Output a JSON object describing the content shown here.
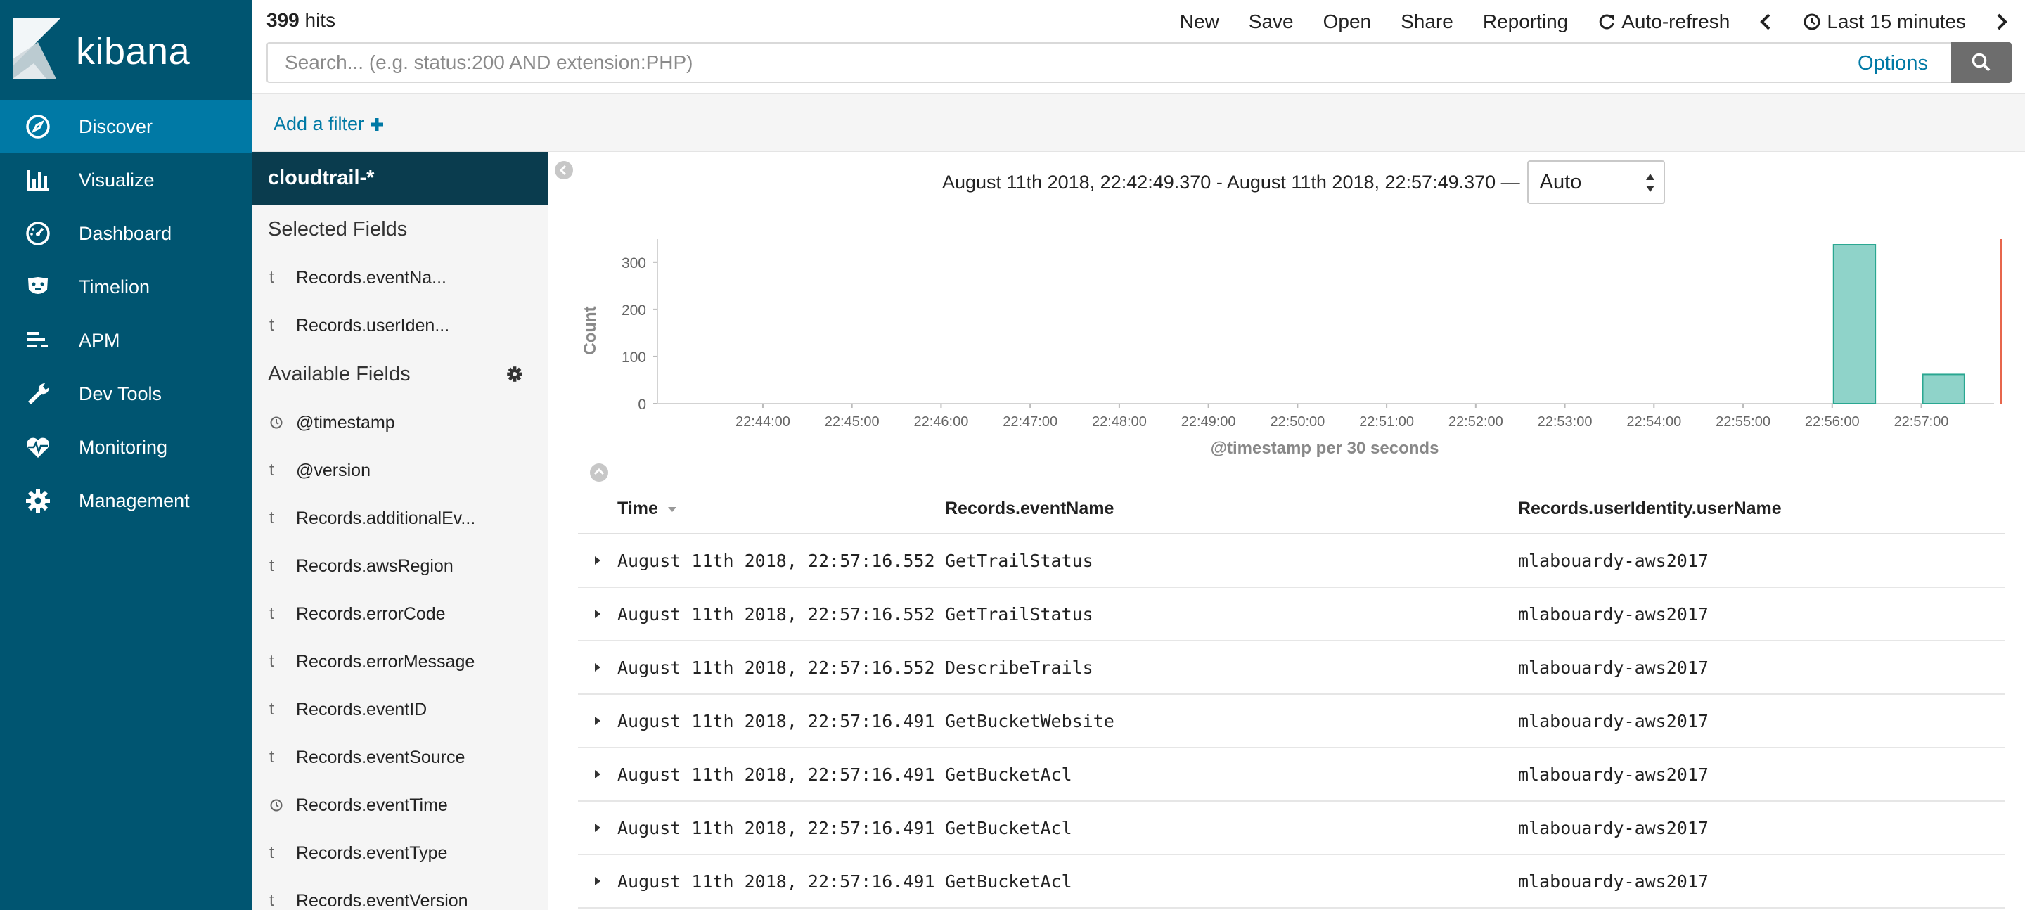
{
  "app": {
    "logo_text": "kibana"
  },
  "sidebar": {
    "items": [
      {
        "label": "Discover",
        "icon": "compass-icon",
        "active": true
      },
      {
        "label": "Visualize",
        "icon": "bar-chart-icon",
        "active": false
      },
      {
        "label": "Dashboard",
        "icon": "dashboard-gauge-icon",
        "active": false
      },
      {
        "label": "Timelion",
        "icon": "timelion-mask-icon",
        "active": false
      },
      {
        "label": "APM",
        "icon": "apm-list-icon",
        "active": false
      },
      {
        "label": "Dev Tools",
        "icon": "wrench-icon",
        "active": false
      },
      {
        "label": "Monitoring",
        "icon": "heartbeat-icon",
        "active": false
      },
      {
        "label": "Management",
        "icon": "gear-icon",
        "active": false
      }
    ]
  },
  "topbar": {
    "hits_count": "399",
    "hits_label": "hits",
    "menu": {
      "new": "New",
      "save": "Save",
      "open": "Open",
      "share": "Share",
      "reporting": "Reporting",
      "auto_refresh": "Auto-refresh",
      "time_picker": "Last 15 minutes"
    }
  },
  "search": {
    "placeholder": "Search... (e.g. status:200 AND extension:PHP)",
    "value": "",
    "options_label": "Options"
  },
  "filter": {
    "add_filter_label": "Add a filter"
  },
  "fieldlist": {
    "index_pattern": "cloudtrail-*",
    "selected_title": "Selected Fields",
    "available_title": "Available Fields",
    "selected": [
      {
        "type": "t",
        "name": "Records.eventNa..."
      },
      {
        "type": "t",
        "name": "Records.userIden..."
      }
    ],
    "available": [
      {
        "type": "clock",
        "name": "@timestamp"
      },
      {
        "type": "t",
        "name": "@version"
      },
      {
        "type": "t",
        "name": "Records.additionalEv..."
      },
      {
        "type": "t",
        "name": "Records.awsRegion"
      },
      {
        "type": "t",
        "name": "Records.errorCode"
      },
      {
        "type": "t",
        "name": "Records.errorMessage"
      },
      {
        "type": "t",
        "name": "Records.eventID"
      },
      {
        "type": "t",
        "name": "Records.eventSource"
      },
      {
        "type": "clock",
        "name": "Records.eventTime"
      },
      {
        "type": "t",
        "name": "Records.eventType"
      },
      {
        "type": "t",
        "name": "Records.eventVersion"
      }
    ]
  },
  "histogram": {
    "time_range": "August 11th 2018, 22:42:49.370 - August 11th 2018, 22:57:49.370 —",
    "interval": "Auto"
  },
  "chart_data": {
    "type": "bar",
    "title": "",
    "xlabel": "@timestamp per 30 seconds",
    "ylabel": "Count",
    "ylim": [
      0,
      340
    ],
    "yticks": [
      0,
      100,
      200,
      300
    ],
    "xticks": [
      "22:44:00",
      "22:45:00",
      "22:46:00",
      "22:47:00",
      "22:48:00",
      "22:49:00",
      "22:50:00",
      "22:51:00",
      "22:52:00",
      "22:53:00",
      "22:54:00",
      "22:55:00",
      "22:56:00",
      "22:57:00"
    ],
    "x_start": "22:42:49",
    "x_end": "22:57:49",
    "bars": [
      {
        "x": "22:56:00",
        "value": 337
      },
      {
        "x": "22:57:00",
        "value": 62
      }
    ],
    "bar_color": "#8fd3c9",
    "bar_edge": "#2aa791",
    "now_line_color": "#e7664c",
    "grid": false
  },
  "table": {
    "columns": [
      "Time",
      "Records.eventName",
      "Records.userIdentity.userName"
    ],
    "rows": [
      {
        "time": "August 11th 2018, 22:57:16.552",
        "event": "GetTrailStatus",
        "user": "mlabouardy-aws2017"
      },
      {
        "time": "August 11th 2018, 22:57:16.552",
        "event": "GetTrailStatus",
        "user": "mlabouardy-aws2017"
      },
      {
        "time": "August 11th 2018, 22:57:16.552",
        "event": "DescribeTrails",
        "user": "mlabouardy-aws2017"
      },
      {
        "time": "August 11th 2018, 22:57:16.491",
        "event": "GetBucketWebsite",
        "user": "mlabouardy-aws2017"
      },
      {
        "time": "August 11th 2018, 22:57:16.491",
        "event": "GetBucketAcl",
        "user": "mlabouardy-aws2017"
      },
      {
        "time": "August 11th 2018, 22:57:16.491",
        "event": "GetBucketAcl",
        "user": "mlabouardy-aws2017"
      },
      {
        "time": "August 11th 2018, 22:57:16.491",
        "event": "GetBucketAcl",
        "user": "mlabouardy-aws2017"
      }
    ]
  }
}
